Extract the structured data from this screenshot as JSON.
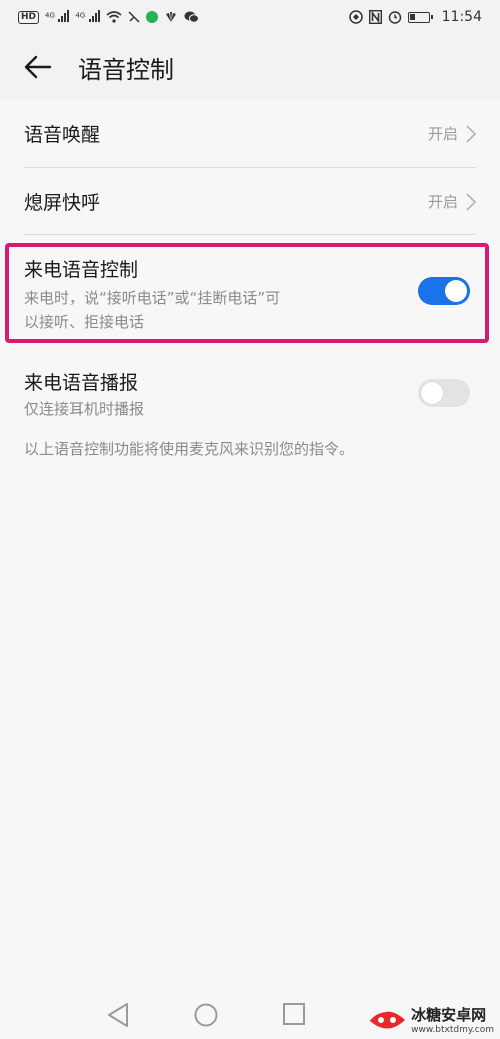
{
  "status_bar": {
    "left_icons": [
      "hd-icon",
      "signal-4g-icon",
      "signal-4g-icon",
      "wifi-icon",
      "mute-icon",
      "green-app-icon",
      "huawei-icon",
      "wechat-icon"
    ],
    "right_icons": [
      "nfc-icon",
      "n-icon",
      "alarm-icon",
      "battery-icon"
    ],
    "hd": "HD",
    "net1": "4G",
    "net2": "4G",
    "time": "11:54"
  },
  "header": {
    "title": "语音控制"
  },
  "settings": {
    "voice_wakeup": {
      "label": "语音唤醒",
      "value": "开启"
    },
    "screen_off_call": {
      "label": "熄屏快呼",
      "value": "开启"
    },
    "incoming_call_control": {
      "label": "来电语音控制",
      "description_line1": "来电时，说“接听电话”或“挂断电话”可",
      "description_line2": "以接听、拒接电话",
      "enabled": true
    },
    "incoming_call_announce": {
      "label": "来电语音播报",
      "description": "仅连接耳机时播报",
      "enabled": false
    }
  },
  "footnote": "以上语音控制功能将使用麦克风来识别您的指令。",
  "nav_bar": [
    "back-icon",
    "home-icon",
    "recents-icon"
  ],
  "watermark": {
    "name": "冰糖安卓网",
    "url": "www.btxtdmy.com"
  },
  "colors": {
    "accent": "#1a73e8",
    "highlight": "#d81b72",
    "background": "#f2f2f2"
  }
}
